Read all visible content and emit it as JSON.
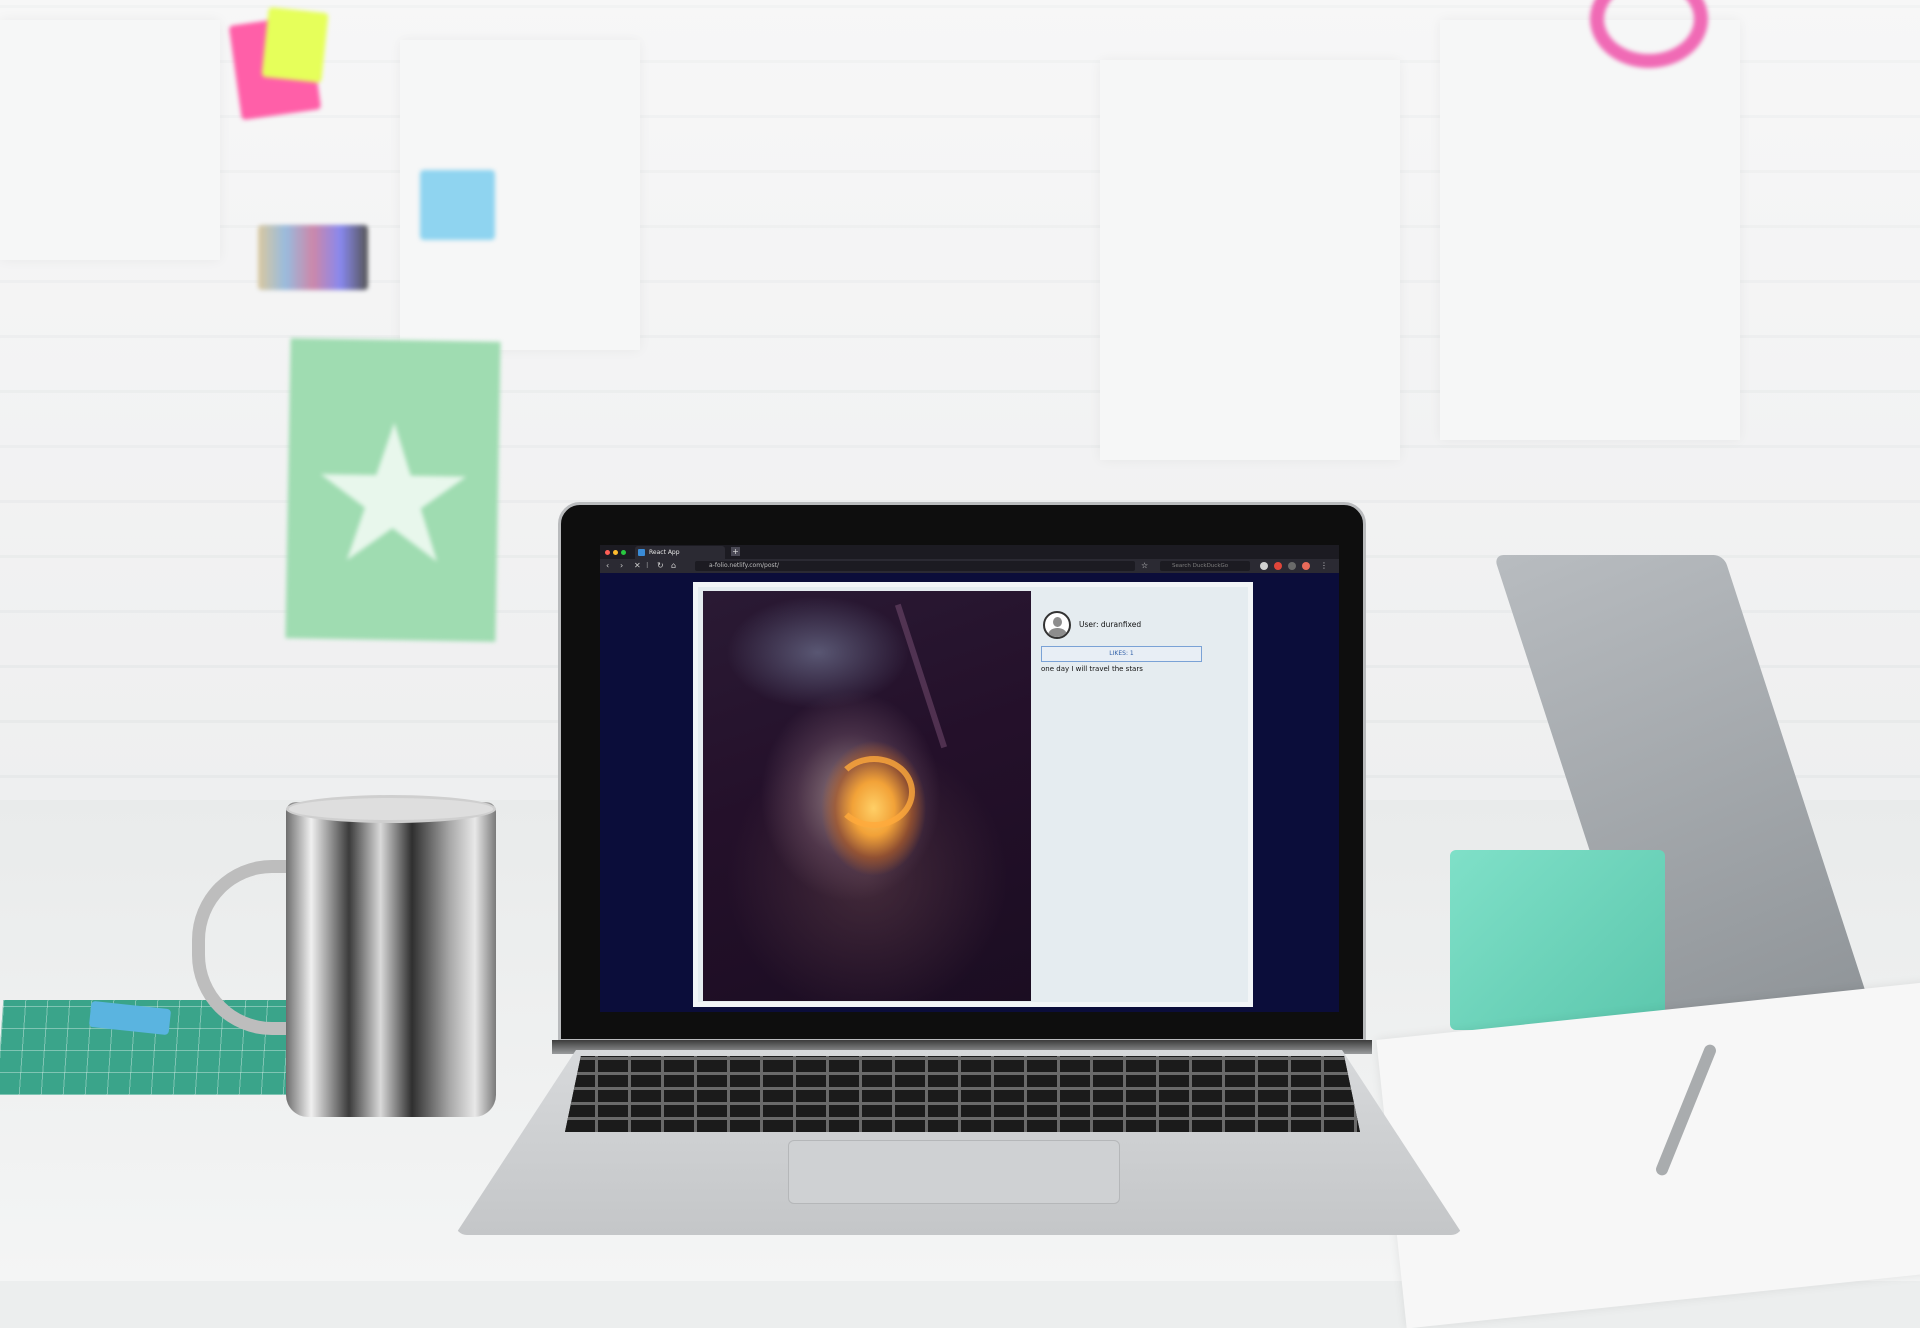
{
  "browser": {
    "tab_title": "React App",
    "new_tab_label": "+",
    "url": "a-folio.netlify.com/post/",
    "search_placeholder": "Search DuckDuckGo"
  },
  "post": {
    "username_label": "User: duranfixed",
    "likes_label": "LIKES: 1",
    "caption": "one day I will travel the stars"
  },
  "colors": {
    "page_background": "#0b0d3a",
    "card_background": "#e5ecf0",
    "likes_border": "#7aa2d6"
  },
  "icons": {
    "back": "back-arrow-icon",
    "forward": "forward-arrow-icon",
    "reload": "reload-icon",
    "home": "home-icon",
    "info": "info-icon"
  }
}
